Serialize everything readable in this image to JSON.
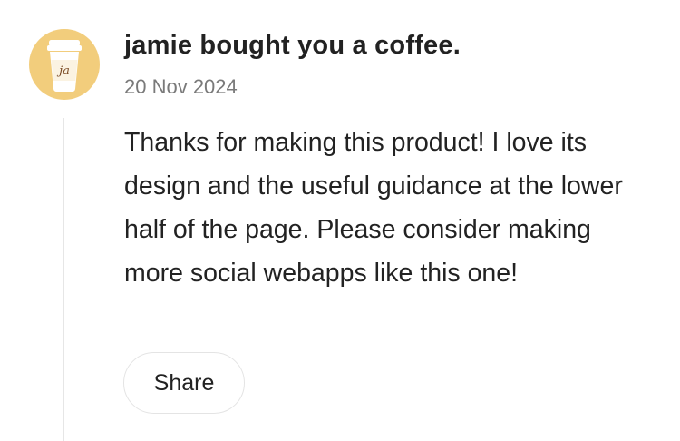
{
  "supporter": {
    "title": "jamie bought you a coffee.",
    "date": "20 Nov 2024",
    "avatar_initials": "ja",
    "avatar_icon": "coffee-cup-icon",
    "avatar_color": "#f2cd7c"
  },
  "message": {
    "text": "Thanks for making this product! I love its design and the useful guidance at the lower half of the page. Please consider making more social webapps like this one!"
  },
  "actions": {
    "share_label": "Share"
  }
}
